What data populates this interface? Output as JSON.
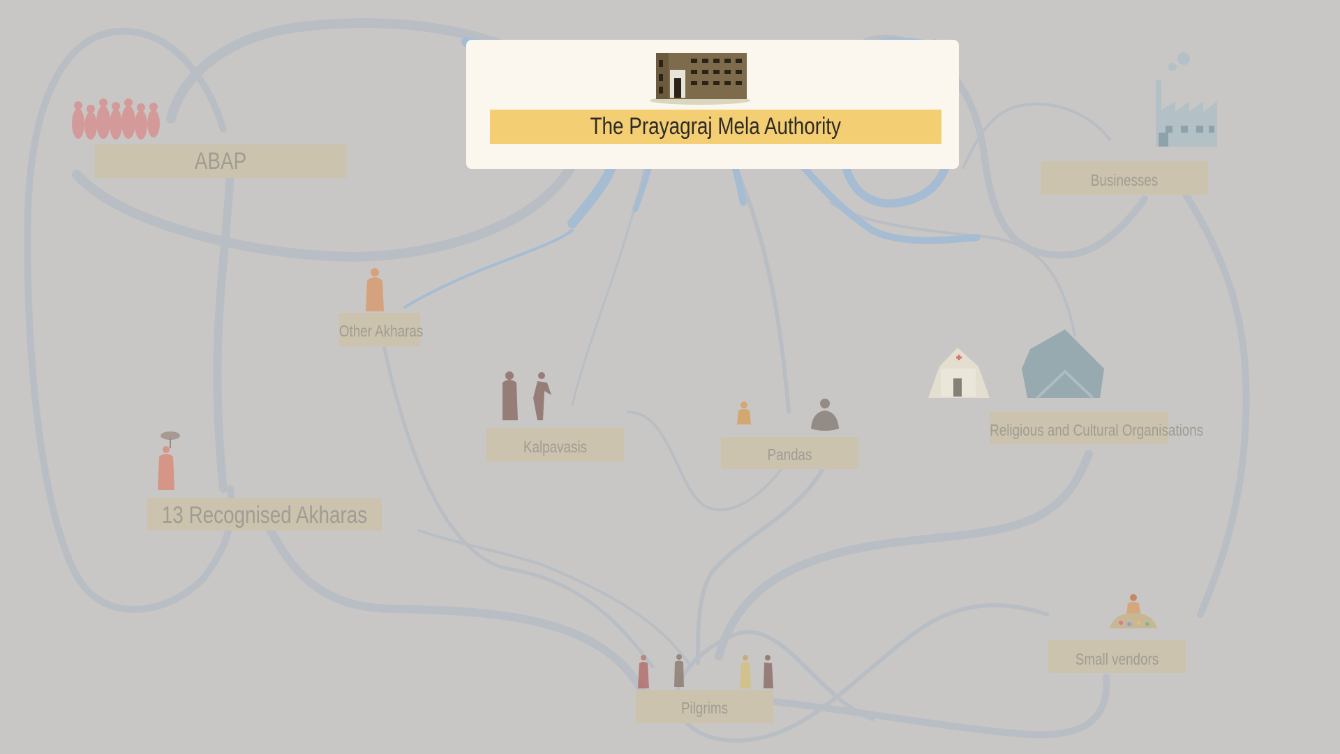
{
  "diagram": {
    "focus_node": {
      "id": "pma",
      "label": "The Prayagraj Mela Authority",
      "icon": "government-building-icon",
      "colors": {
        "card": "#fcf7ee",
        "label_bg": "#f4ce72",
        "label_text": "#2c2a27"
      }
    },
    "nodes": [
      {
        "id": "abap",
        "label": "ABAP",
        "icon": "sadhu-group-icon"
      },
      {
        "id": "businesses",
        "label": "Businesses",
        "icon": "factory-icon"
      },
      {
        "id": "other-akharas",
        "label": "Other Akharas",
        "icon": "sadhu-icon"
      },
      {
        "id": "kalpavasis",
        "label": "Kalpavasis",
        "icon": "kalpavasi-figures-icon"
      },
      {
        "id": "pandas",
        "label": "Pandas",
        "icon": "panda-priests-icon"
      },
      {
        "id": "religious-orgs",
        "label": "Religious and Cultural Organisations",
        "icon": "tent-and-clinic-icon"
      },
      {
        "id": "recognised-akharas",
        "label": "13 Recognised Akharas",
        "icon": "umbrella-sadhu-icon"
      },
      {
        "id": "small-vendors",
        "label": "Small vendors",
        "icon": "vendor-stall-icon"
      },
      {
        "id": "pilgrims",
        "label": "Pilgrims",
        "icon": "pilgrims-icon"
      }
    ],
    "colors": {
      "background": "#c8c7c5",
      "dimmed_label_bg": "#ccc3ae",
      "dimmed_label_text": "#a09c94",
      "flow_highlight": "#a6bcd3",
      "flow_dim": "#b9bec4"
    }
  }
}
